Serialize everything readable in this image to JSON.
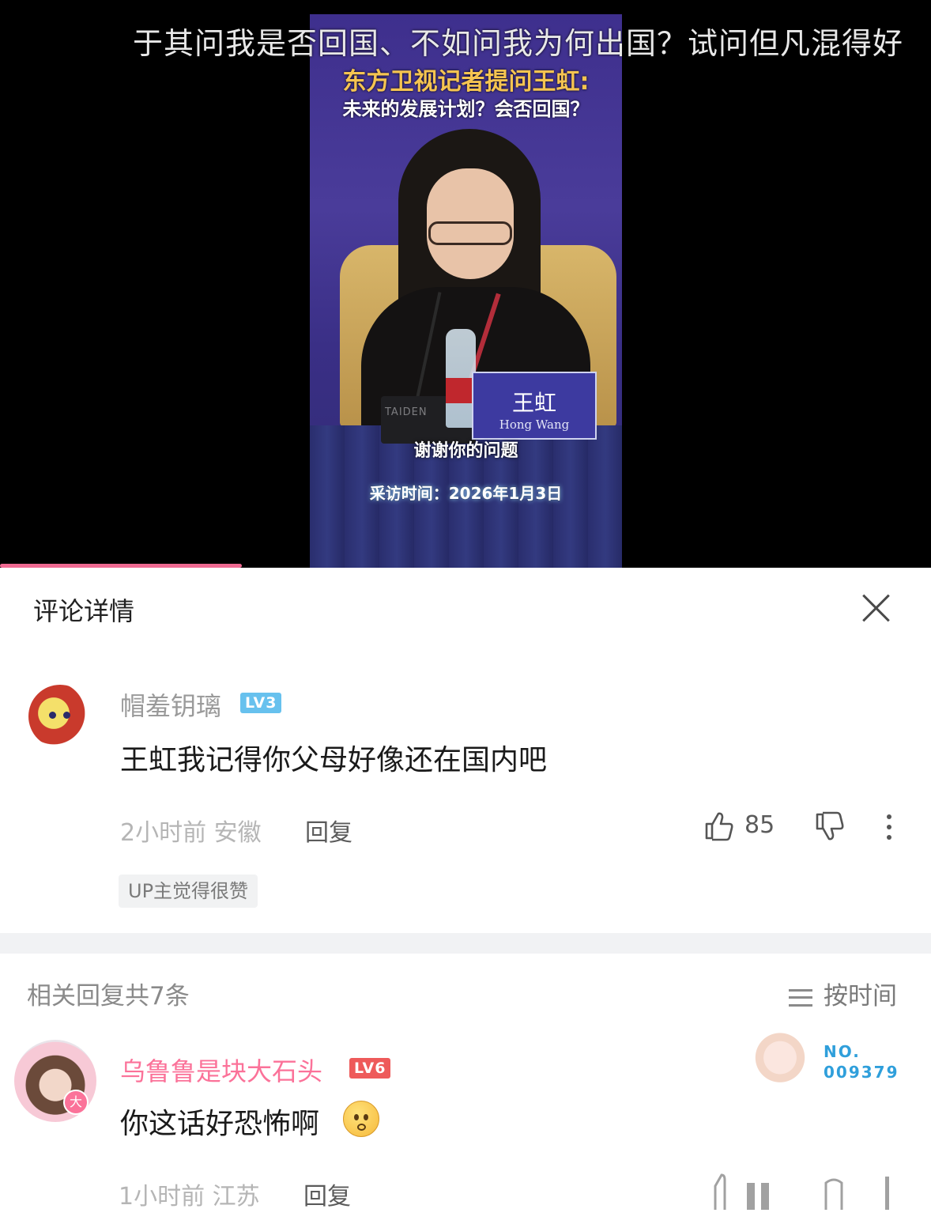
{
  "video": {
    "danmaku": "于其问我是否回国、不如问我为何出国？试问但凡混得好",
    "headline_line1": "东方卫视记者提问王虹:",
    "headline_line2": "未来的发展计划？会否回国？",
    "nameplate_cn": "王虹",
    "nameplate_en": "Hong Wang",
    "mic_brand": "TAIDEN",
    "subtitle": "谢谢你的问题",
    "date_caption": "采访时间：2026年1月3日",
    "progress_fraction": 0.26
  },
  "panel": {
    "title": "评论详情"
  },
  "main_comment": {
    "username": "帽羞钥璃",
    "level": "LV3",
    "text": "王虹我记得你父母好像还在国内吧",
    "time_location": "2小时前 安徽",
    "reply_label": "回复",
    "likes": "85",
    "up_tag": "UP主觉得很赞"
  },
  "replies_section": {
    "count_label": "相关回复共7条",
    "sort_label": "按时间"
  },
  "reply_comment": {
    "username": "乌鲁鲁是块大石头",
    "level": "LV6",
    "avatar_badge": "大",
    "text": "你这话好恐怖啊",
    "fan_no": "NO.",
    "fan_number": "009379",
    "time_location": "1小时前 江苏",
    "reply_label": "回复"
  },
  "colors": {
    "accent_pink": "#fb7299",
    "level3": "#67c1ee",
    "level6": "#ee5a5a",
    "progress": "#f06a92"
  },
  "icons": [
    "close-icon",
    "thumbs-up-icon",
    "thumbs-down-icon",
    "more-vertical-icon",
    "sort-icon"
  ]
}
